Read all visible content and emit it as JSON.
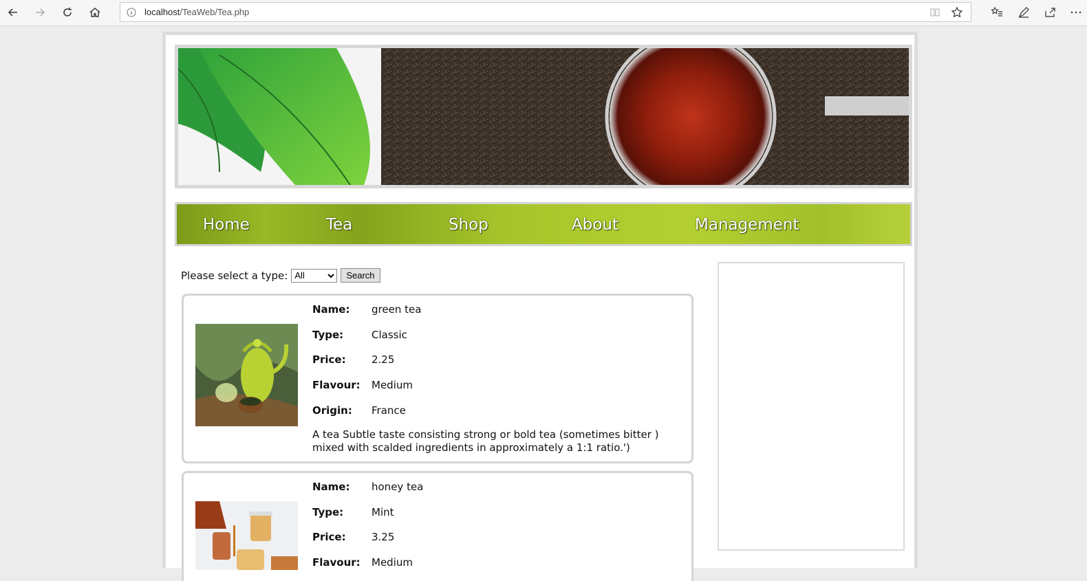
{
  "browser": {
    "url_host": "localhost",
    "url_path": "/TeaWeb/Tea.php"
  },
  "nav": {
    "items": [
      "Home",
      "Tea",
      "Shop",
      "About",
      "Management"
    ]
  },
  "filter": {
    "label": "Please select a type:",
    "selected": "All",
    "search_label": "Search"
  },
  "field_labels": {
    "name": "Name:",
    "type": "Type:",
    "price": "Price:",
    "flavour": "Flavour:",
    "origin": "Origin:"
  },
  "teas": [
    {
      "name": "green tea",
      "type": "Classic",
      "price": "2.25",
      "flavour": "Medium",
      "origin": "France",
      "description": "A tea Subtle taste consisting strong or bold tea (sometimes bitter ) mixed with scalded ingredients in approximately a 1:1 ratio.')"
    },
    {
      "name": "honey tea",
      "type": "Mint",
      "price": "3.25",
      "flavour": "Medium"
    }
  ]
}
